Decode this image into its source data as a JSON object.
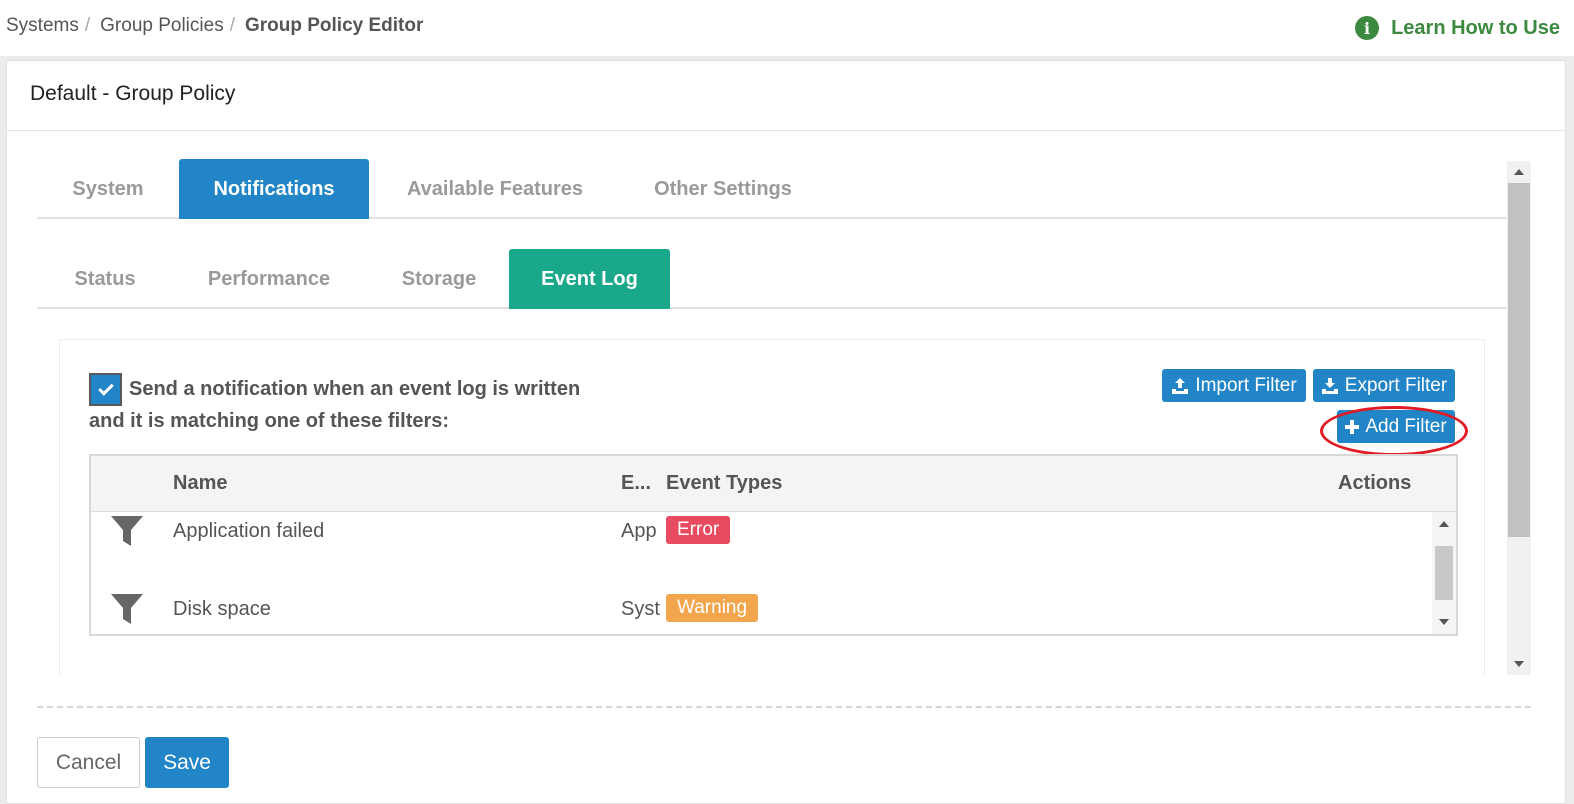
{
  "breadcrumb": {
    "items": [
      "Systems",
      "Group Policies",
      "Group Policy Editor"
    ],
    "separator": "/"
  },
  "help": {
    "label": "Learn How to Use",
    "icon": "info-icon",
    "color": "#3c8a3f"
  },
  "panel": {
    "title": "Default - Group Policy"
  },
  "main_tabs": [
    {
      "label": "System",
      "active": false
    },
    {
      "label": "Notifications",
      "active": true
    },
    {
      "label": "Available Features",
      "active": false
    },
    {
      "label": "Other Settings",
      "active": false
    }
  ],
  "sub_tabs": [
    {
      "label": "Status",
      "active": false
    },
    {
      "label": "Performance",
      "active": false
    },
    {
      "label": "Storage",
      "active": false
    },
    {
      "label": "Event Log",
      "active": true
    }
  ],
  "event_log": {
    "notify_checked": true,
    "notify_text": "Send a notification when an event log is written and it is matching one of these filters:",
    "buttons": {
      "import": "Import Filter",
      "export": "Export Filter",
      "add": "Add Filter"
    },
    "table": {
      "columns": [
        "Name",
        "E...",
        "Event Types",
        "Actions"
      ],
      "rows": [
        {
          "name": "Application failed",
          "log": "App",
          "event_type": "Error",
          "event_type_color": "#e84a5f"
        },
        {
          "name": "Disk space",
          "log": "Syst",
          "event_type": "Warning",
          "event_type_color": "#f3a54e"
        }
      ]
    }
  },
  "footer": {
    "cancel": "Cancel",
    "save": "Save"
  },
  "colors": {
    "primary": "#2185c8",
    "secondary": "#1aa88a",
    "highlight_ring": "#e01b24"
  }
}
